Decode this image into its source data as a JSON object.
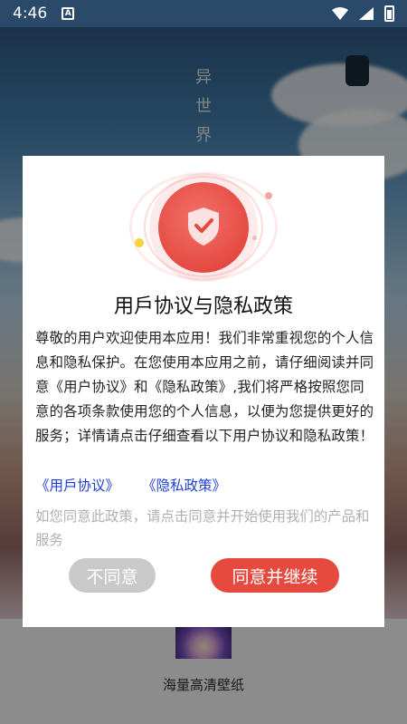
{
  "status_bar": {
    "time": "4:46",
    "notification_icon": "A"
  },
  "background": {
    "vertical_text": [
      "异",
      "世",
      "界"
    ],
    "bottom_caption": "海量高清壁纸"
  },
  "dialog": {
    "title": "用戶协议与隐私政策",
    "body": "尊敬的用户欢迎使用本应用！我们非常重视您的个人信息和隐私保护。在您使用本应用之前，请仔细阅读并同意《用户协议》和《隐私政策》,我们将严格按照您同意的各项条款使用您的个人信息，以便为您提供更好的服务；详情请点击仔细查看以下用户协议和隐私政策！",
    "link_user_agreement": "《用戶协议》",
    "link_privacy_policy": "《隐私政策》",
    "hint": "如您同意此政策，请点击同意并开始使用我们的产品和服务",
    "disagree_label": "不同意",
    "agree_label": "同意并继续"
  },
  "colors": {
    "accent": "#e64a3f",
    "link": "#1f3fd6",
    "disabled_button": "#c9c9c9"
  },
  "icons": [
    "wifi-icon",
    "signal-icon",
    "battery-icon",
    "shield-check-icon"
  ]
}
